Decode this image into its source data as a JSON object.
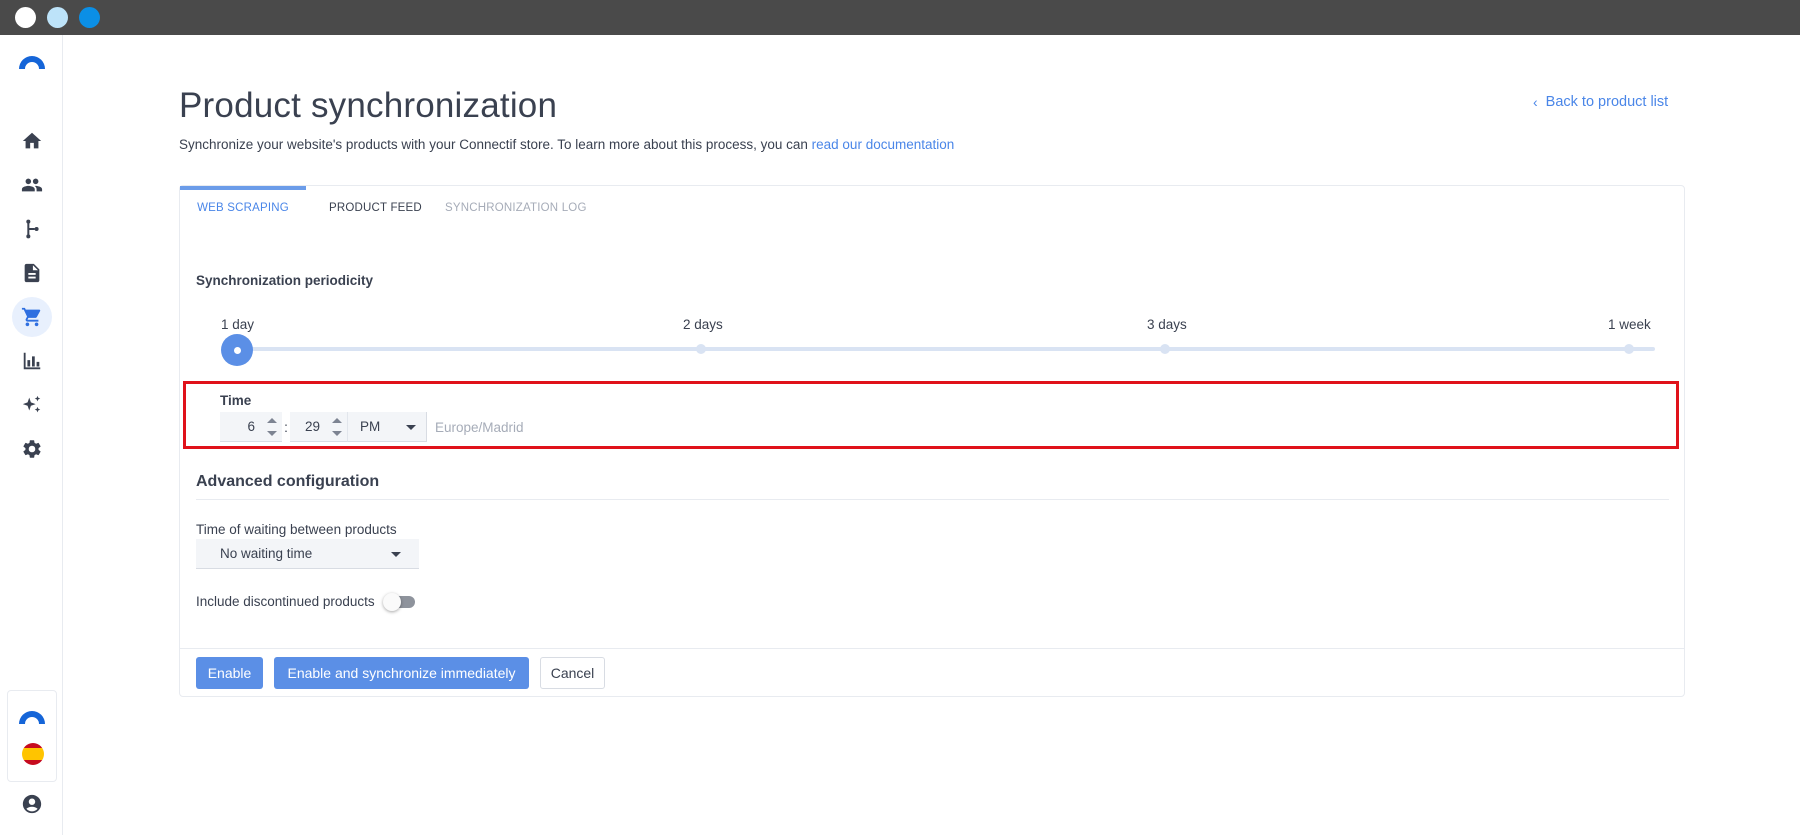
{
  "page": {
    "title": "Product synchronization",
    "subtitle": "Synchronize your website's products with your Connectif store. To learn more about this process, you can ",
    "doc_link": "read our documentation",
    "back_link": "Back to product list"
  },
  "sidebar": {
    "items": [
      {
        "icon": "home-icon"
      },
      {
        "icon": "contacts-icon"
      },
      {
        "icon": "workflows-icon"
      },
      {
        "icon": "content-icon"
      },
      {
        "icon": "store-icon",
        "active": true
      },
      {
        "icon": "reports-icon"
      },
      {
        "icon": "ai-sparkle-icon"
      },
      {
        "icon": "settings-icon"
      }
    ],
    "bottom": [
      "connectif-logo",
      "spain-flag-icon",
      "user-account-icon"
    ]
  },
  "tabs": [
    "WEB SCRAPING",
    "PRODUCT FEED",
    "SYNCHRONIZATION LOG"
  ],
  "periodicity": {
    "label": "Synchronization periodicity",
    "options": [
      "1 day",
      "2 days",
      "3 days",
      "1 week"
    ],
    "selected": "1 day"
  },
  "time": {
    "label": "Time",
    "hour": "6",
    "separator": ":",
    "minute": "29",
    "ampm": "PM",
    "timezone": "Europe/Madrid"
  },
  "advanced": {
    "title": "Advanced configuration",
    "wait_label": "Time of waiting between products",
    "wait_value": "No waiting time",
    "discontinued_label": "Include discontinued products",
    "discontinued_enabled": false
  },
  "buttons": {
    "enable": "Enable",
    "enable_sync": "Enable and synchronize immediately",
    "cancel": "Cancel"
  },
  "colors": {
    "accent": "#4a86e8",
    "primary_button": "#5b8fe6",
    "highlight_border": "#e0121a"
  }
}
